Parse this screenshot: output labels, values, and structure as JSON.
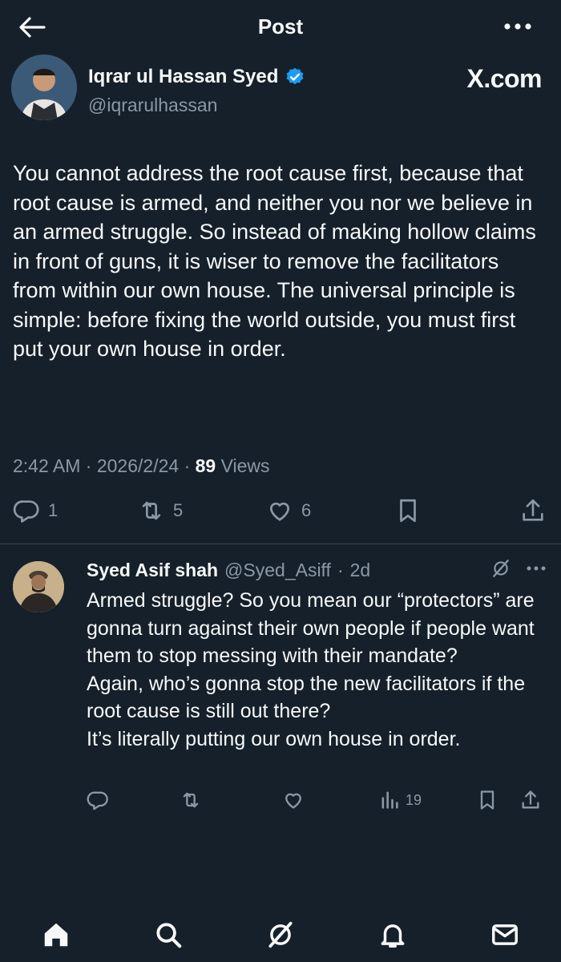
{
  "header": {
    "title": "Post",
    "back_icon": "arrow-left-icon",
    "more_icon": "more-dots-icon"
  },
  "author": {
    "name": "Iqrar ul Hassan Syed",
    "handle": "@iqrarulhassan",
    "verified": true,
    "watermark": "X.com"
  },
  "post": {
    "text": "You cannot address the root cause first, because that root cause is armed, and neither you nor we believe in an armed struggle. So instead of making hollow claims in front of guns, it is wiser to remove the facilitators from within our own house. The universal principle is simple: before fixing the world outside, you must first put your own house in order.",
    "time": "2:42 AM",
    "date": "2026/2/24",
    "views_count": "89",
    "views_label": "Views",
    "replies": "1",
    "reposts": "5",
    "likes": "6"
  },
  "reply": {
    "name": "Syed Asif shah",
    "handle": "@Syed_Asiff",
    "age": "2d",
    "text": "Armed struggle? So you mean our “protectors” are gonna turn against their own people if people want them to stop messing with their mandate?\nAgain, who’s gonna stop the new facilitators if the root cause is still out there?\nIt’s literally putting our own house in order.",
    "views": "19"
  },
  "colors": {
    "background": "#15202b",
    "text": "#f7f9f9",
    "muted": "#8b98a5",
    "divider": "#38444d",
    "verified": "#1d9bf0"
  },
  "bottom_nav": [
    "home-icon",
    "search-icon",
    "grok-icon",
    "notifications-icon",
    "messages-icon"
  ]
}
